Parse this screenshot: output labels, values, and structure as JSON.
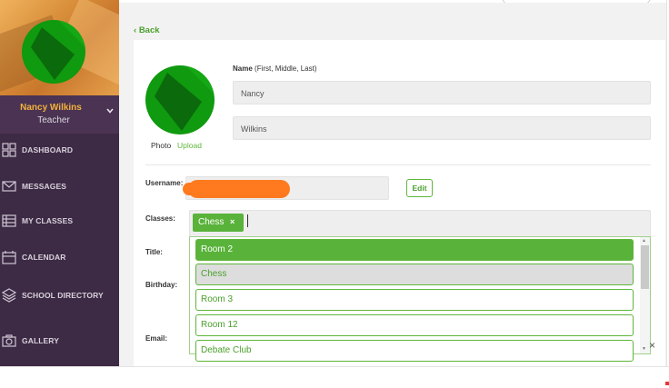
{
  "sidebar": {
    "profile": {
      "name": "Nancy Wilkins",
      "role": "Teacher"
    },
    "items": [
      {
        "label": "DASHBOARD",
        "icon": "dashboard-grid-icon"
      },
      {
        "label": "MESSAGES",
        "icon": "envelope-icon"
      },
      {
        "label": "MY CLASSES",
        "icon": "list-icon"
      },
      {
        "label": "CALENDAR",
        "icon": "calendar-icon"
      },
      {
        "label": "SCHOOL DIRECTORY",
        "icon": "layers-icon"
      },
      {
        "label": "GALLERY",
        "icon": "camera-icon"
      }
    ]
  },
  "main": {
    "back_label": "Back",
    "photo": {
      "label": "Photo",
      "upload_label": "Upload"
    },
    "name": {
      "label_bold": "Name",
      "label_hint": "(First, Middle, Last)",
      "first": "Nancy",
      "last": "Wilkins"
    },
    "username": {
      "label": "Username:",
      "edit_label": "Edit"
    },
    "classes": {
      "label": "Classes:",
      "chips": [
        {
          "label": "Chess",
          "remove": "×"
        }
      ],
      "options": [
        "Room 2",
        "Chess",
        "Room 3",
        "Room 12",
        "Debate Club"
      ],
      "highlighted_index": 0,
      "selected_index": 1
    },
    "labels": {
      "title": "Title:",
      "birthday": "Birthday:",
      "email": "Email:"
    },
    "clear_symbol": "×"
  },
  "colors": {
    "sidebar_bg": "#3d2a45",
    "accent_green": "#59b33a",
    "profile_name": "#f4b23a",
    "redaction": "#ff7a1f"
  }
}
